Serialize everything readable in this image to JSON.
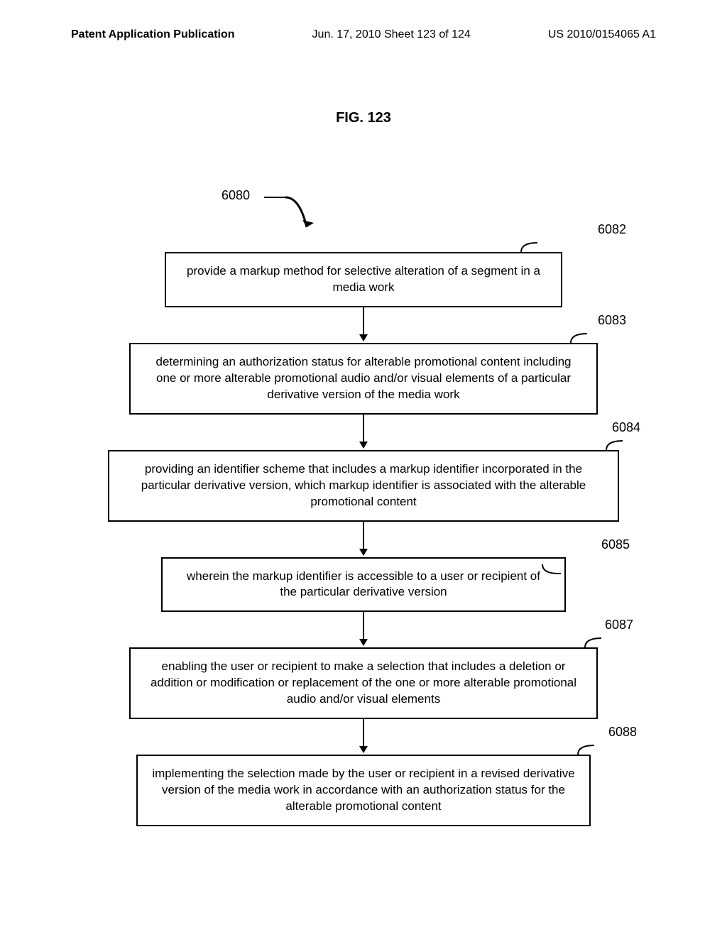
{
  "header": {
    "left": "Patent Application Publication",
    "center": "Jun. 17, 2010  Sheet 123 of 124",
    "right": "US 2010/0154065 A1"
  },
  "figure_title": "FIG. 123",
  "refs": {
    "main": "6080",
    "block1": "6082",
    "block2": "6083",
    "block3": "6084",
    "block4": "6085",
    "block5": "6087",
    "block6": "6088"
  },
  "blocks": {
    "b1": "provide a markup method for selective alteration of a segment in a media work",
    "b2": "determining an authorization status for alterable promotional content including one or more alterable promotional audio and/or visual elements of a particular derivative version of the media work",
    "b3": "providing an identifier scheme that includes a markup identifier incorporated in the particular derivative version, which markup identifier is associated with the alterable promotional content",
    "b4": "wherein the markup identifier is accessible to a user or recipient of the particular derivative version",
    "b5": "enabling the user or recipient to make a selection that includes a deletion or addition or modification or replacement of the one or more alterable promotional audio and/or visual elements",
    "b6": "implementing the selection made by the user or recipient in a revised derivative version of the media work in accordance with an authorization status for the alterable promotional content"
  }
}
